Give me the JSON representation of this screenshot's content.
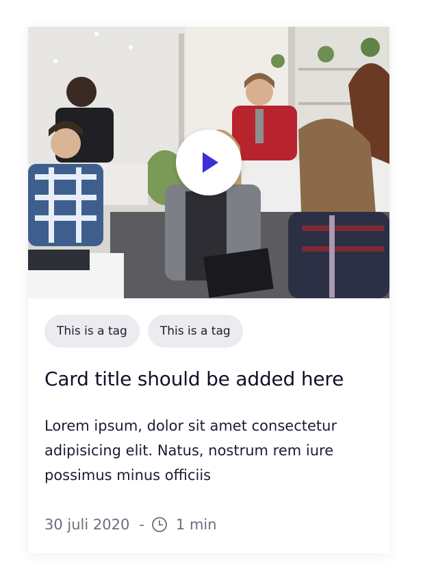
{
  "card": {
    "tags": [
      "This is a tag",
      "This is a tag"
    ],
    "title": "Card title should be added here",
    "description": "Lorem ipsum, dolor sit amet consectetur adipisicing elit. Natus, nostrum rem iure possimus minus officiis",
    "date": "30 juli 2020",
    "separator": "-",
    "duration": "1 min"
  },
  "media": {
    "play_icon": "play-icon",
    "accent_color": "#3b2fd6"
  },
  "icons": {
    "clock": "clock-icon"
  }
}
